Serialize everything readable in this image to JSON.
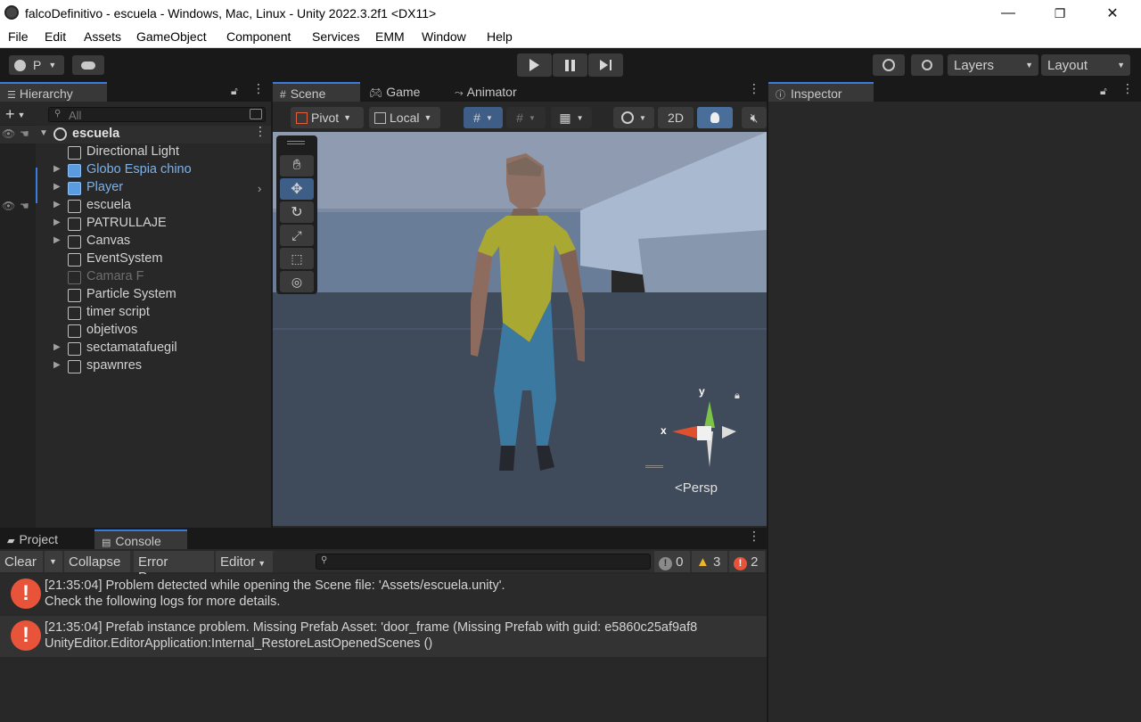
{
  "window": {
    "title": "falcoDefinitivo - escuela - Windows, Mac, Linux - Unity 2022.3.2f1 <DX11>",
    "minimize": "—",
    "maximize": "❐",
    "close": "✕"
  },
  "menu": [
    "File",
    "Edit",
    "Assets",
    "GameObject",
    "Component",
    "Services",
    "EMM",
    "Window",
    "Help"
  ],
  "toolbar": {
    "account_label": "P",
    "layers_label": "Layers",
    "layout_label": "Layout"
  },
  "hierarchy": {
    "tab_label": "Hierarchy",
    "search_placeholder": "All",
    "scene_name": "escuela",
    "items": [
      {
        "label": "Directional Light",
        "expandable": false,
        "style": "normal"
      },
      {
        "label": "Globo Espia chino",
        "expandable": true,
        "style": "prefab"
      },
      {
        "label": "Player",
        "expandable": true,
        "style": "prefab"
      },
      {
        "label": "escuela",
        "expandable": true,
        "style": "normal"
      },
      {
        "label": "PATRULLAJE",
        "expandable": true,
        "style": "normal"
      },
      {
        "label": "Canvas",
        "expandable": true,
        "style": "normal"
      },
      {
        "label": "EventSystem",
        "expandable": false,
        "style": "normal"
      },
      {
        "label": "Camara F",
        "expandable": false,
        "style": "disabled"
      },
      {
        "label": "Particle System",
        "expandable": false,
        "style": "normal"
      },
      {
        "label": "timer script",
        "expandable": false,
        "style": "normal"
      },
      {
        "label": "objetivos",
        "expandable": false,
        "style": "normal"
      },
      {
        "label": "sectamatafuegil",
        "expandable": true,
        "style": "normal"
      },
      {
        "label": "spawnres",
        "expandable": true,
        "style": "normal"
      }
    ]
  },
  "scene": {
    "tabs": [
      "Scene",
      "Game",
      "Animator"
    ],
    "pivot_label": "Pivot",
    "local_label": "Local",
    "mode_2d": "2D",
    "gizmo_y": "y",
    "gizmo_x": "x",
    "persp_label": "Persp"
  },
  "inspector": {
    "tab_label": "Inspector"
  },
  "console": {
    "tabs": [
      "Project",
      "Console"
    ],
    "clear": "Clear",
    "collapse": "Collapse",
    "error_pause": "Error Pause",
    "editor": "Editor",
    "count_info": "0",
    "count_warn": "3",
    "count_error": "2",
    "messages": [
      {
        "line1": "[21:35:04] Problem detected while opening the Scene file: 'Assets/escuela.unity'.",
        "line2": "Check the following logs for more details."
      },
      {
        "line1": "[21:35:04] Prefab instance problem. Missing Prefab Asset: 'door_frame (Missing Prefab with guid: e5860c25af9af8",
        "line2": "UnityEditor.EditorApplication:Internal_RestoreLastOpenedScenes ()"
      }
    ]
  },
  "colors": {
    "accent": "#3b7be0",
    "error": "#e8543a",
    "warning": "#f0b429",
    "prefab_text": "#7cb2ea"
  }
}
